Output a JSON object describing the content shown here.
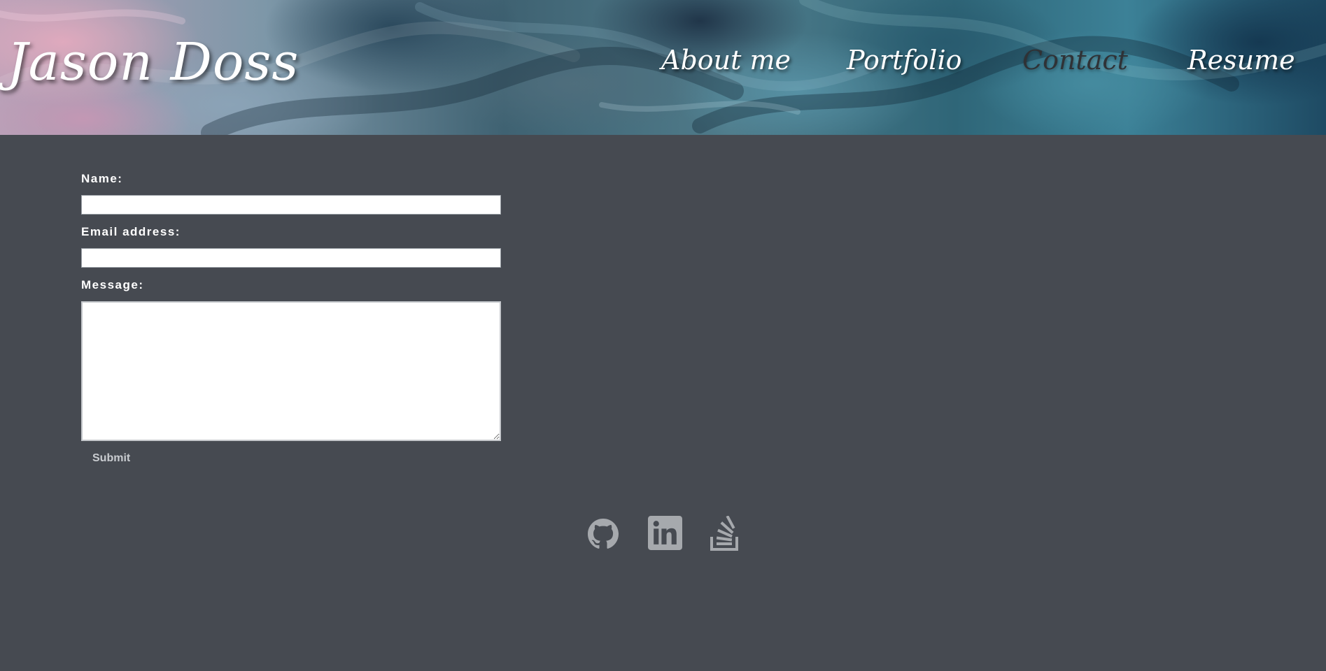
{
  "header": {
    "site_title": "Jason Doss",
    "nav": [
      {
        "label": "About me",
        "active": false
      },
      {
        "label": "Portfolio",
        "active": false
      },
      {
        "label": "Contact",
        "active": true
      },
      {
        "label": "Resume",
        "active": false
      }
    ]
  },
  "form": {
    "name_label": "Name:",
    "name_value": "",
    "email_label": "Email address:",
    "email_value": "",
    "message_label": "Message:",
    "message_value": "",
    "submit_label": "Submit"
  },
  "social": [
    {
      "icon": "github-icon"
    },
    {
      "icon": "linkedin-icon"
    },
    {
      "icon": "stackoverflow-icon"
    }
  ],
  "colors": {
    "page_background": "#464a51",
    "icon_color": "#a6a9ad",
    "active_nav": "#2f3236"
  }
}
